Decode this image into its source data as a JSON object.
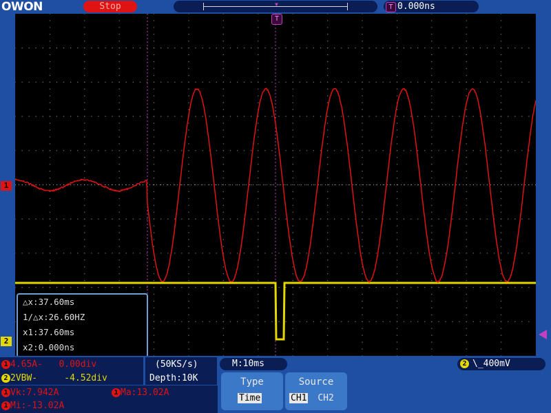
{
  "header": {
    "logo": "OWON",
    "status": "Stop",
    "trigger_marker": "T",
    "trigger_time": "0.000ns"
  },
  "screen": {
    "ch1_marker": "1",
    "ch2_marker": "2",
    "trigger_top_marker": "T"
  },
  "cursor_panel": {
    "dx": "△x:37.60ms",
    "inv_dx": "1/△x:26.60HZ",
    "x1": "x1:37.60ms",
    "x2": "x2:0.000ns"
  },
  "channel_info": {
    "ch1_label": "1",
    "ch1_text": "4.65A-   0.00div",
    "ch2_label": "2",
    "ch2_text": "2VBW-     -4.52div"
  },
  "acquisition": {
    "sample_rate": "(50KS/s)",
    "depth": "Depth:10K"
  },
  "timebase": {
    "label": "M:10ms"
  },
  "trigger_info": {
    "channel": "2",
    "text": "\\_400mV"
  },
  "measurements": {
    "vk_label": "1",
    "vk": "Vk:7.942A",
    "ma_label": "1",
    "ma": "Ma:13.02A",
    "mi_label": "1",
    "mi": "Mi:-13.02A"
  },
  "menu": {
    "type_label": "Type",
    "type_value": "Time",
    "source_label": "Source",
    "source_options": [
      "CH1",
      "CH2"
    ],
    "source_selected": "CH1"
  },
  "colors": {
    "ch1": "#e01313",
    "ch2": "#e5d800",
    "trigger": "#c040c0",
    "background": "#1f4fa3"
  }
}
